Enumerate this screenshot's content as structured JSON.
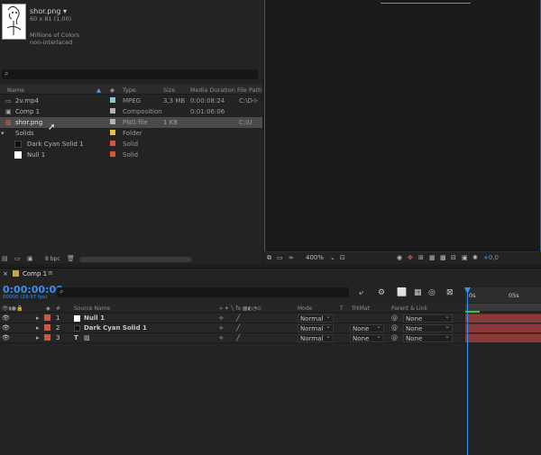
{
  "project": {
    "selected_item": {
      "name": "shor.png",
      "dimensions": "60 x 81 (1,00)",
      "colors": "Millions of Colors",
      "interlace": "non-interlaced"
    },
    "search": {
      "icon": "search-icon"
    },
    "columns": {
      "name": "Name",
      "type": "Type",
      "size": "Size",
      "duration": "Media Duration",
      "path": "File Path"
    },
    "items": [
      {
        "name": "2v.mp4",
        "type": "MPEG",
        "size": "3,3 MB",
        "duration": "0:00:08:24",
        "path": "C:\\D",
        "label_color": "#8fc9d9"
      },
      {
        "name": "Comp 1",
        "type": "Composition",
        "size": "",
        "duration": "0:01:06:06",
        "path": "",
        "label_color": "#b3b3b3"
      },
      {
        "name": "shor.png",
        "type": "PNG file",
        "size": "1 KB",
        "duration": "",
        "path": "C:\\U",
        "label_color": "#b3b3b3"
      },
      {
        "name": "Solids",
        "type": "Folder",
        "size": "",
        "duration": "",
        "path": "",
        "label_color": "#e8c33a"
      },
      {
        "name": "Dark Cyan Solid 1",
        "type": "Solid",
        "size": "",
        "duration": "",
        "path": "",
        "label_color": "#d8523c"
      },
      {
        "name": "Null 1",
        "type": "Solid",
        "size": "",
        "duration": "",
        "path": "",
        "label_color": "#d8523c"
      }
    ],
    "footer": {
      "bpc": "8 bpc"
    }
  },
  "viewer": {
    "zoom": "400%",
    "offset": "+0,0"
  },
  "timeline": {
    "tab": "Comp 1",
    "timecode": "0:00:00:00",
    "timecode_sub": "00000 (29.97 fps)",
    "ruler": {
      "start": "0s",
      "mark": "05s"
    },
    "columns": {
      "num": "#",
      "source": "Source Name",
      "mode": "Mode",
      "t": "T",
      "trkmat": "TrkMat",
      "parent": "Parent & Link"
    },
    "layers": [
      {
        "num": "1",
        "name": "Null 1",
        "mode": "Normal",
        "trkmat": "",
        "parent": "None",
        "label_color": "#d8523c"
      },
      {
        "num": "2",
        "name": "Dark Cyan Solid 1",
        "mode": "Normal",
        "trkmat": "None",
        "parent": "None",
        "label_color": "#d8523c"
      },
      {
        "num": "3",
        "name": "",
        "mode": "Normal",
        "trkmat": "None",
        "parent": "None",
        "label_color": "#d8523c"
      }
    ]
  }
}
